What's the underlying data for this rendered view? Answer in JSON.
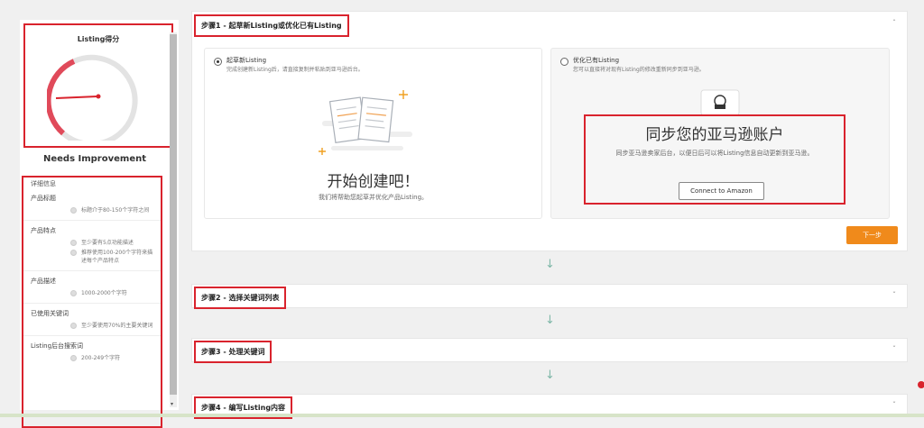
{
  "sidebar": {
    "score_title": "Listing得分",
    "score_label": "Needs Improvement",
    "details_title": "详细信息",
    "criteria": [
      {
        "heading": "产品标题",
        "items": [
          "标题介于80-150个字符之间"
        ]
      },
      {
        "heading": "产品特点",
        "items": [
          "至少要有5点功能描述",
          "推荐使用100-200个字符来描述每个产品特点"
        ]
      },
      {
        "heading": "产品描述",
        "items": [
          "1000-2000个字符"
        ]
      },
      {
        "heading": "已使用关键词",
        "items": [
          "至少要使用70%的主要关键词"
        ]
      },
      {
        "heading": "Listing后台搜索词",
        "items": [
          "200-249个字符"
        ]
      }
    ],
    "scroll_arrow": "▾"
  },
  "steps": {
    "step1": {
      "title": "步骤1 - 起草新Listing或优化已有Listing",
      "option_new": {
        "title": "起草新Listing",
        "desc": "完成创建新Listing后，请直接复制并粘贴到亚马逊后台。",
        "headline": "开始创建吧！",
        "subtext": "我们将帮助您起草并优化产品Listing。"
      },
      "option_existing": {
        "title": "优化已有Listing",
        "desc": "您可以直接将对现有Listing的修改重新同步到亚马逊。",
        "headline": "同步您的亚马逊账户",
        "subtext": "同步亚马逊卖家后台，以便日后可以将Listing信息自动更新到亚马逊。",
        "button": "Connect to Amazon"
      },
      "next_button": "下一步"
    },
    "step2": {
      "title": "步骤2 - 选择关键词列表"
    },
    "step3": {
      "title": "步骤3 - 处理关键词"
    },
    "step4": {
      "title": "步骤4 - 编写Listing内容"
    }
  },
  "icons": {
    "chevron_up": "ˆ",
    "chevron_down": "ˇ",
    "down_arrow": "↓"
  },
  "colors": {
    "highlight": "#d9232d",
    "accent": "#f08a1b",
    "gauge_red": "#e04a5a",
    "gauge_gray": "#e3e3e3"
  }
}
